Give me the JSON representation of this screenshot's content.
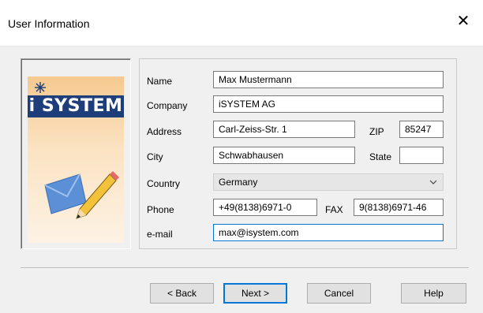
{
  "window": {
    "title": "User Information"
  },
  "branding": {
    "logo_text": "i SYSTEM"
  },
  "form": {
    "name": {
      "label": "Name",
      "value": "Max Mustermann"
    },
    "company": {
      "label": "Company",
      "value": "iSYSTEM AG"
    },
    "address": {
      "label": "Address",
      "value": "Carl-Zeiss-Str. 1"
    },
    "zip": {
      "label": "ZIP",
      "value": "85247"
    },
    "city": {
      "label": "City",
      "value": "Schwabhausen"
    },
    "state": {
      "label": "State",
      "value": ""
    },
    "country": {
      "label": "Country",
      "value": "Germany"
    },
    "phone": {
      "label": "Phone",
      "value": "+49(8138)6971-0"
    },
    "fax": {
      "label": "FAX",
      "value": "9(8138)6971-46"
    },
    "email": {
      "label": "e-mail",
      "value": "max@isystem.com"
    }
  },
  "buttons": {
    "back": "< Back",
    "next": "Next >",
    "cancel": "Cancel",
    "help": "Help"
  },
  "colors": {
    "logo_band": "#1d3e7b",
    "focus_border": "#0078d7"
  }
}
